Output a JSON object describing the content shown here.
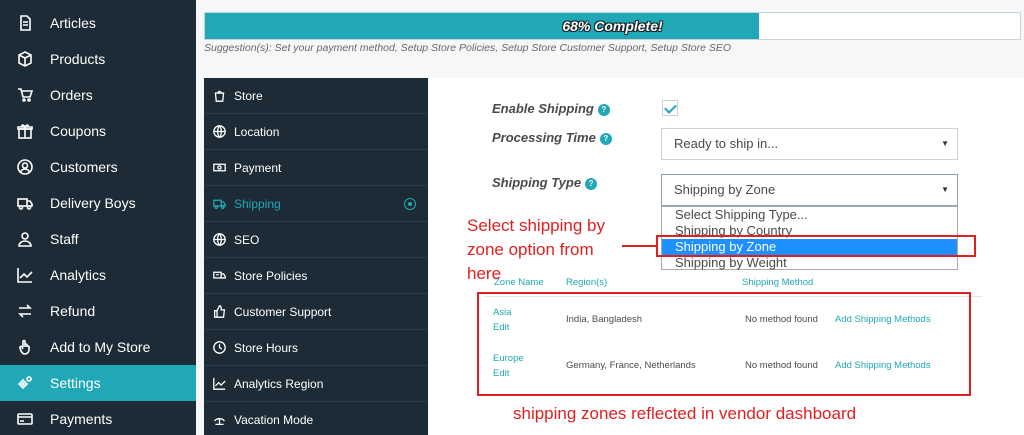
{
  "sidebar": {
    "items": [
      {
        "label": "Articles",
        "icon": "document-icon"
      },
      {
        "label": "Products",
        "icon": "cube-icon"
      },
      {
        "label": "Orders",
        "icon": "cart-icon"
      },
      {
        "label": "Coupons",
        "icon": "gift-icon"
      },
      {
        "label": "Customers",
        "icon": "user-circle-icon"
      },
      {
        "label": "Delivery Boys",
        "icon": "truck-icon"
      },
      {
        "label": "Staff",
        "icon": "user-icon"
      },
      {
        "label": "Analytics",
        "icon": "chart-icon"
      },
      {
        "label": "Refund",
        "icon": "refund-icon"
      },
      {
        "label": "Add to My Store",
        "icon": "hand-icon"
      },
      {
        "label": "Settings",
        "icon": "cogs-icon",
        "active": true
      },
      {
        "label": "Payments",
        "icon": "credit-card-icon"
      }
    ]
  },
  "progress": {
    "text": "68% Complete!",
    "value": 0.68
  },
  "suggestions": "Suggestion(s): Set your payment method, Setup Store Policies, Setup Store Customer Support, Setup Store SEO",
  "tabs": [
    {
      "label": "Store",
      "icon": "bag-icon"
    },
    {
      "label": "Location",
      "icon": "globe-icon"
    },
    {
      "label": "Payment",
      "icon": "money-icon"
    },
    {
      "label": "Shipping",
      "icon": "truck-icon",
      "active": true
    },
    {
      "label": "SEO",
      "icon": "globe-icon"
    },
    {
      "label": "Store Policies",
      "icon": "policy-icon"
    },
    {
      "label": "Customer Support",
      "icon": "thumbs-up-icon"
    },
    {
      "label": "Store Hours",
      "icon": "clock-icon"
    },
    {
      "label": "Analytics Region",
      "icon": "chart-icon"
    },
    {
      "label": "Vacation Mode",
      "icon": "vacation-icon"
    }
  ],
  "form": {
    "enable_shipping_label": "Enable Shipping",
    "enable_shipping_checked": true,
    "processing_time_label": "Processing Time",
    "processing_time_value": "Ready to ship in...",
    "shipping_type_label": "Shipping Type",
    "shipping_type_value": "Shipping by Zone",
    "help_glyph": "?"
  },
  "dropdown": {
    "options": [
      "Select Shipping Type...",
      "Shipping by Country",
      "Shipping by Zone",
      "Shipping by Weight"
    ],
    "selected_index": 2
  },
  "zones_table": {
    "headers": {
      "zone_name": "Zone Name",
      "regions": "Region(s)",
      "method": "Shipping Method"
    },
    "rows": [
      {
        "name": "Asia",
        "edit": "Edit",
        "regions": "India, Bangladesh",
        "method": "No method found",
        "action": "Add Shipping Methods"
      },
      {
        "name": "Europe",
        "edit": "Edit",
        "regions": "Germany, France, Netherlands",
        "method": "No method found",
        "action": "Add Shipping Methods"
      }
    ]
  },
  "annotations": {
    "select_note": "Select shipping by zone option from here",
    "zones_note": "shipping zones reflected in vendor dashboard",
    "color": "#e02020"
  },
  "colors": {
    "accent": "#20a8b6",
    "sidebar": "#1c2b36",
    "dropdown_highlight": "#1e90ff"
  }
}
